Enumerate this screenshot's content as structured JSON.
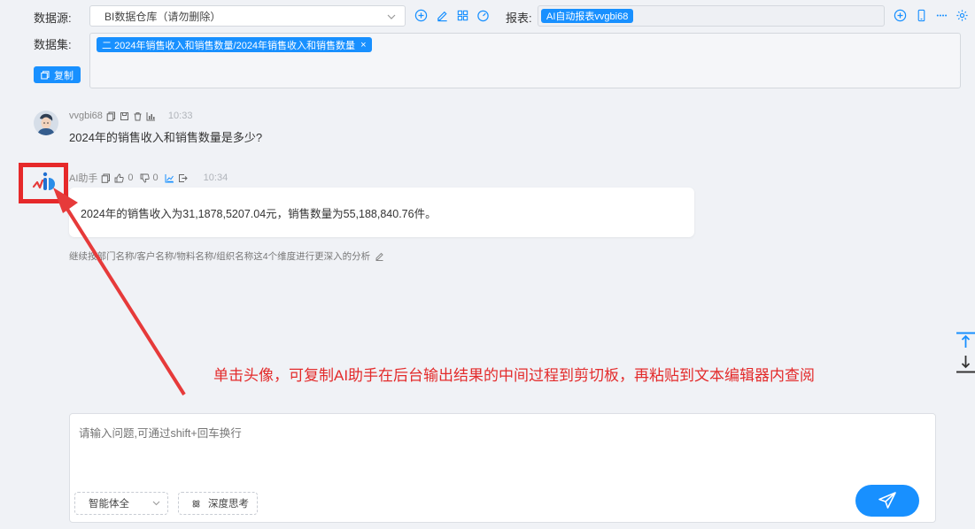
{
  "toolbar": {
    "datasource_label": "数据源:",
    "datasource_value": "BI数据仓库（请勿删除）",
    "report_label": "报表:",
    "report_value": "AI自动报表vvgbi68",
    "dataset_label": "数据集:",
    "dataset_tag": "二 2024年销售收入和销售数量/2024年销售收入和销售数量",
    "dataset_tag_close": "×",
    "copy_label": "复制"
  },
  "chat": {
    "user": {
      "name": "vvgbi68",
      "time": "10:33",
      "message": "2024年的销售收入和销售数量是多少?"
    },
    "assistant": {
      "name": "AI助手",
      "like_count": "0",
      "dislike_count": "0",
      "time": "10:34",
      "answer": "2024年的销售收入为31,1878,5207.04元，销售数量为55,188,840.76件。",
      "suggestion": "继续按部门名称/客户名称/物料名称/组织名称这4个维度进行更深入的分析"
    }
  },
  "annotation": {
    "text": "单击头像，可复制AI助手在后台输出结果的中间过程到剪切板，再粘贴到文本编辑器内查阅",
    "color": "#e32b2b"
  },
  "input": {
    "placeholder": "请输入问题,可通过shift+回车换行",
    "mode_value": "智能体全",
    "deep_think_label": "深度思考"
  },
  "colors": {
    "accent": "#1890ff",
    "annotation": "#e32b2b"
  }
}
